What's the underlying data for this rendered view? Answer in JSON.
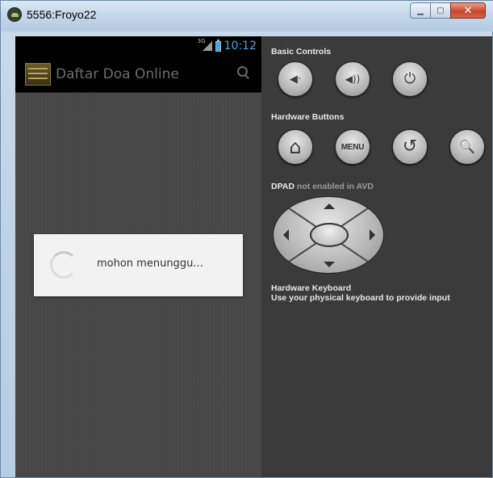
{
  "window": {
    "title": "5556:Froyo22",
    "minimize_glyph": "▁",
    "maximize_glyph": "▢",
    "close_glyph": "✕"
  },
  "phone": {
    "status": {
      "signal_label": "3G",
      "time": "10:12"
    },
    "app_title": "Daftar Doa Online",
    "dialog_message": "mohon menunggu..."
  },
  "controls": {
    "basic_controls_label": "Basic Controls",
    "hardware_buttons_label": "Hardware Buttons",
    "dpad_label": "DPAD",
    "dpad_note": "not enabled in AVD",
    "keyboard_label": "Hardware Keyboard",
    "keyboard_note": "Use your physical keyboard to provide input",
    "volume_down_glyph": "◀·",
    "volume_up_glyph": "◀))",
    "power_glyph": "⏻",
    "home_glyph": "⌂",
    "menu_label": "MENU",
    "back_glyph": "↺",
    "search_glyph": "🔍"
  },
  "colors": {
    "accent_blue": "#4fa3d9",
    "panel_bg": "#3b3b3b",
    "screen_bg": "#474747"
  }
}
